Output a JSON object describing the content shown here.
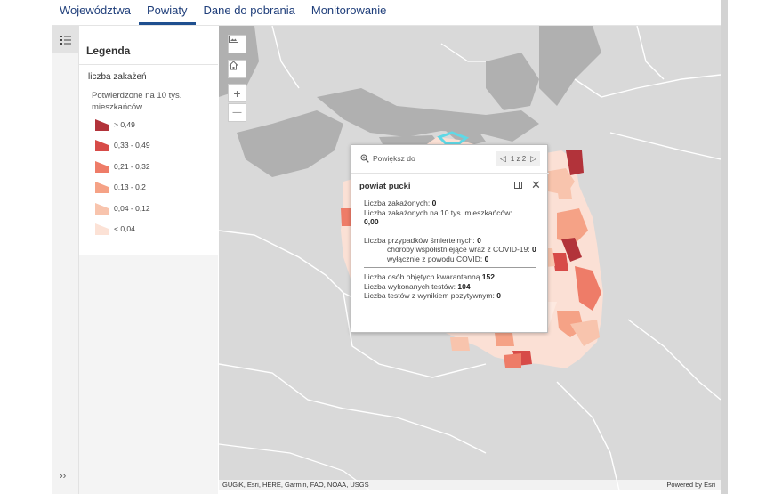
{
  "tabs": [
    {
      "label": "Województwa"
    },
    {
      "label": "Powiaty"
    },
    {
      "label": "Dane do pobrania"
    },
    {
      "label": "Monitorowanie"
    }
  ],
  "active_tab": "Powiaty",
  "legend": {
    "title": "Legenda",
    "layer": "liczba zakażeń",
    "field": "Potwierdzone na 10 tys. mieszkańców",
    "classes": [
      {
        "label": "> 0,49",
        "color": "#b2333a"
      },
      {
        "label": "0,33 - 0,49",
        "color": "#d74b48"
      },
      {
        "label": "0,21 - 0,32",
        "color": "#ee7c68"
      },
      {
        "label": "0,13 - 0,2",
        "color": "#f5a286"
      },
      {
        "label": "0,04 - 0,12",
        "color": "#f8c4ad"
      },
      {
        "label": "< 0,04",
        "color": "#fce2d6"
      }
    ]
  },
  "map": {
    "controls": [
      "basemap-icon",
      "home-icon",
      "zoom-in-icon",
      "zoom-out-icon"
    ],
    "zoom_in": "+",
    "zoom_out": "—",
    "attribution": "GUGiK, Esri, HERE, Garmin, FAO, NOAA, USGS",
    "powered_by": "Powered by Esri"
  },
  "popup": {
    "zoom_to": "Powiększ do",
    "pager": "1 z 2",
    "title": "powiat pucki",
    "infected_label": "Liczba zakażonych:",
    "infected_value": "0",
    "infected_per10k_label": "Liczba zakażonych na 10 tys. mieszkańców:",
    "infected_per10k_value": "0,00",
    "deaths_label": "Liczba przypadków śmiertelnych:",
    "deaths_value": "0",
    "comorbid_label": "choroby współistniejące wraz z COVID-19:",
    "comorbid_value": "0",
    "covid_only_label": "wyłącznie z powodu COVID:",
    "covid_only_value": "0",
    "quarantine_label": "Liczba osób objętych kwarantanną",
    "quarantine_value": "152",
    "tests_label": "Liczba wykonanych testów:",
    "tests_value": "104",
    "positive_label": "Liczba testów z wynikiem pozytywnym:",
    "positive_value": "0"
  },
  "colors": {
    "tab_text": "#1f3e7a",
    "land": "#d9d9d9",
    "water": "#b0b0b0",
    "accent": "#1f4f8f"
  }
}
